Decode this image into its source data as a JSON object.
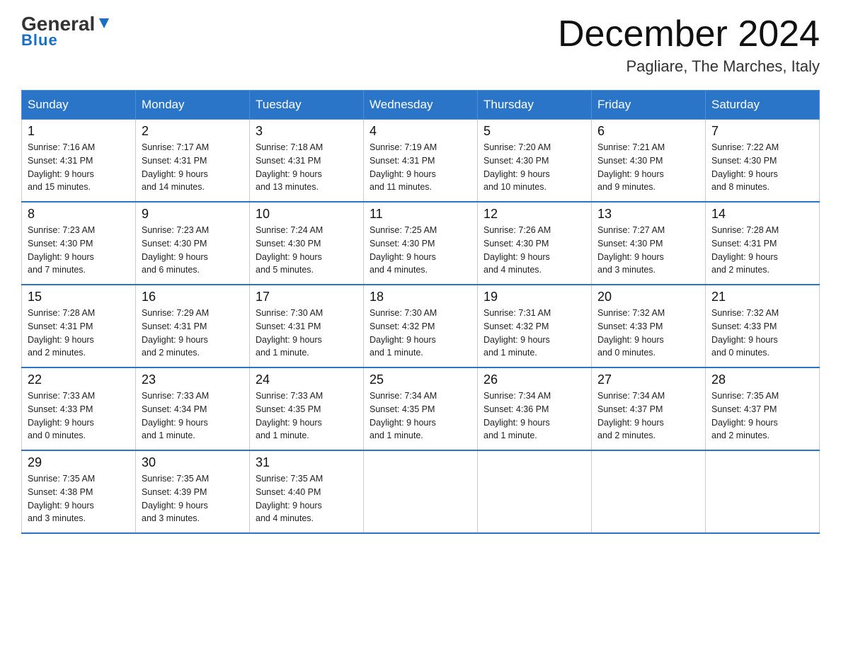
{
  "logo": {
    "general": "General",
    "blue": "Blue"
  },
  "header": {
    "title": "December 2024",
    "subtitle": "Pagliare, The Marches, Italy"
  },
  "days_of_week": [
    "Sunday",
    "Monday",
    "Tuesday",
    "Wednesday",
    "Thursday",
    "Friday",
    "Saturday"
  ],
  "weeks": [
    [
      {
        "day": "1",
        "sunrise": "7:16 AM",
        "sunset": "4:31 PM",
        "daylight": "9 hours and 15 minutes."
      },
      {
        "day": "2",
        "sunrise": "7:17 AM",
        "sunset": "4:31 PM",
        "daylight": "9 hours and 14 minutes."
      },
      {
        "day": "3",
        "sunrise": "7:18 AM",
        "sunset": "4:31 PM",
        "daylight": "9 hours and 13 minutes."
      },
      {
        "day": "4",
        "sunrise": "7:19 AM",
        "sunset": "4:31 PM",
        "daylight": "9 hours and 11 minutes."
      },
      {
        "day": "5",
        "sunrise": "7:20 AM",
        "sunset": "4:30 PM",
        "daylight": "9 hours and 10 minutes."
      },
      {
        "day": "6",
        "sunrise": "7:21 AM",
        "sunset": "4:30 PM",
        "daylight": "9 hours and 9 minutes."
      },
      {
        "day": "7",
        "sunrise": "7:22 AM",
        "sunset": "4:30 PM",
        "daylight": "9 hours and 8 minutes."
      }
    ],
    [
      {
        "day": "8",
        "sunrise": "7:23 AM",
        "sunset": "4:30 PM",
        "daylight": "9 hours and 7 minutes."
      },
      {
        "day": "9",
        "sunrise": "7:23 AM",
        "sunset": "4:30 PM",
        "daylight": "9 hours and 6 minutes."
      },
      {
        "day": "10",
        "sunrise": "7:24 AM",
        "sunset": "4:30 PM",
        "daylight": "9 hours and 5 minutes."
      },
      {
        "day": "11",
        "sunrise": "7:25 AM",
        "sunset": "4:30 PM",
        "daylight": "9 hours and 4 minutes."
      },
      {
        "day": "12",
        "sunrise": "7:26 AM",
        "sunset": "4:30 PM",
        "daylight": "9 hours and 4 minutes."
      },
      {
        "day": "13",
        "sunrise": "7:27 AM",
        "sunset": "4:30 PM",
        "daylight": "9 hours and 3 minutes."
      },
      {
        "day": "14",
        "sunrise": "7:28 AM",
        "sunset": "4:31 PM",
        "daylight": "9 hours and 2 minutes."
      }
    ],
    [
      {
        "day": "15",
        "sunrise": "7:28 AM",
        "sunset": "4:31 PM",
        "daylight": "9 hours and 2 minutes."
      },
      {
        "day": "16",
        "sunrise": "7:29 AM",
        "sunset": "4:31 PM",
        "daylight": "9 hours and 2 minutes."
      },
      {
        "day": "17",
        "sunrise": "7:30 AM",
        "sunset": "4:31 PM",
        "daylight": "9 hours and 1 minute."
      },
      {
        "day": "18",
        "sunrise": "7:30 AM",
        "sunset": "4:32 PM",
        "daylight": "9 hours and 1 minute."
      },
      {
        "day": "19",
        "sunrise": "7:31 AM",
        "sunset": "4:32 PM",
        "daylight": "9 hours and 1 minute."
      },
      {
        "day": "20",
        "sunrise": "7:32 AM",
        "sunset": "4:33 PM",
        "daylight": "9 hours and 0 minutes."
      },
      {
        "day": "21",
        "sunrise": "7:32 AM",
        "sunset": "4:33 PM",
        "daylight": "9 hours and 0 minutes."
      }
    ],
    [
      {
        "day": "22",
        "sunrise": "7:33 AM",
        "sunset": "4:33 PM",
        "daylight": "9 hours and 0 minutes."
      },
      {
        "day": "23",
        "sunrise": "7:33 AM",
        "sunset": "4:34 PM",
        "daylight": "9 hours and 1 minute."
      },
      {
        "day": "24",
        "sunrise": "7:33 AM",
        "sunset": "4:35 PM",
        "daylight": "9 hours and 1 minute."
      },
      {
        "day": "25",
        "sunrise": "7:34 AM",
        "sunset": "4:35 PM",
        "daylight": "9 hours and 1 minute."
      },
      {
        "day": "26",
        "sunrise": "7:34 AM",
        "sunset": "4:36 PM",
        "daylight": "9 hours and 1 minute."
      },
      {
        "day": "27",
        "sunrise": "7:34 AM",
        "sunset": "4:37 PM",
        "daylight": "9 hours and 2 minutes."
      },
      {
        "day": "28",
        "sunrise": "7:35 AM",
        "sunset": "4:37 PM",
        "daylight": "9 hours and 2 minutes."
      }
    ],
    [
      {
        "day": "29",
        "sunrise": "7:35 AM",
        "sunset": "4:38 PM",
        "daylight": "9 hours and 3 minutes."
      },
      {
        "day": "30",
        "sunrise": "7:35 AM",
        "sunset": "4:39 PM",
        "daylight": "9 hours and 3 minutes."
      },
      {
        "day": "31",
        "sunrise": "7:35 AM",
        "sunset": "4:40 PM",
        "daylight": "9 hours and 4 minutes."
      },
      null,
      null,
      null,
      null
    ]
  ],
  "labels": {
    "sunrise": "Sunrise:",
    "sunset": "Sunset:",
    "daylight": "Daylight:"
  }
}
